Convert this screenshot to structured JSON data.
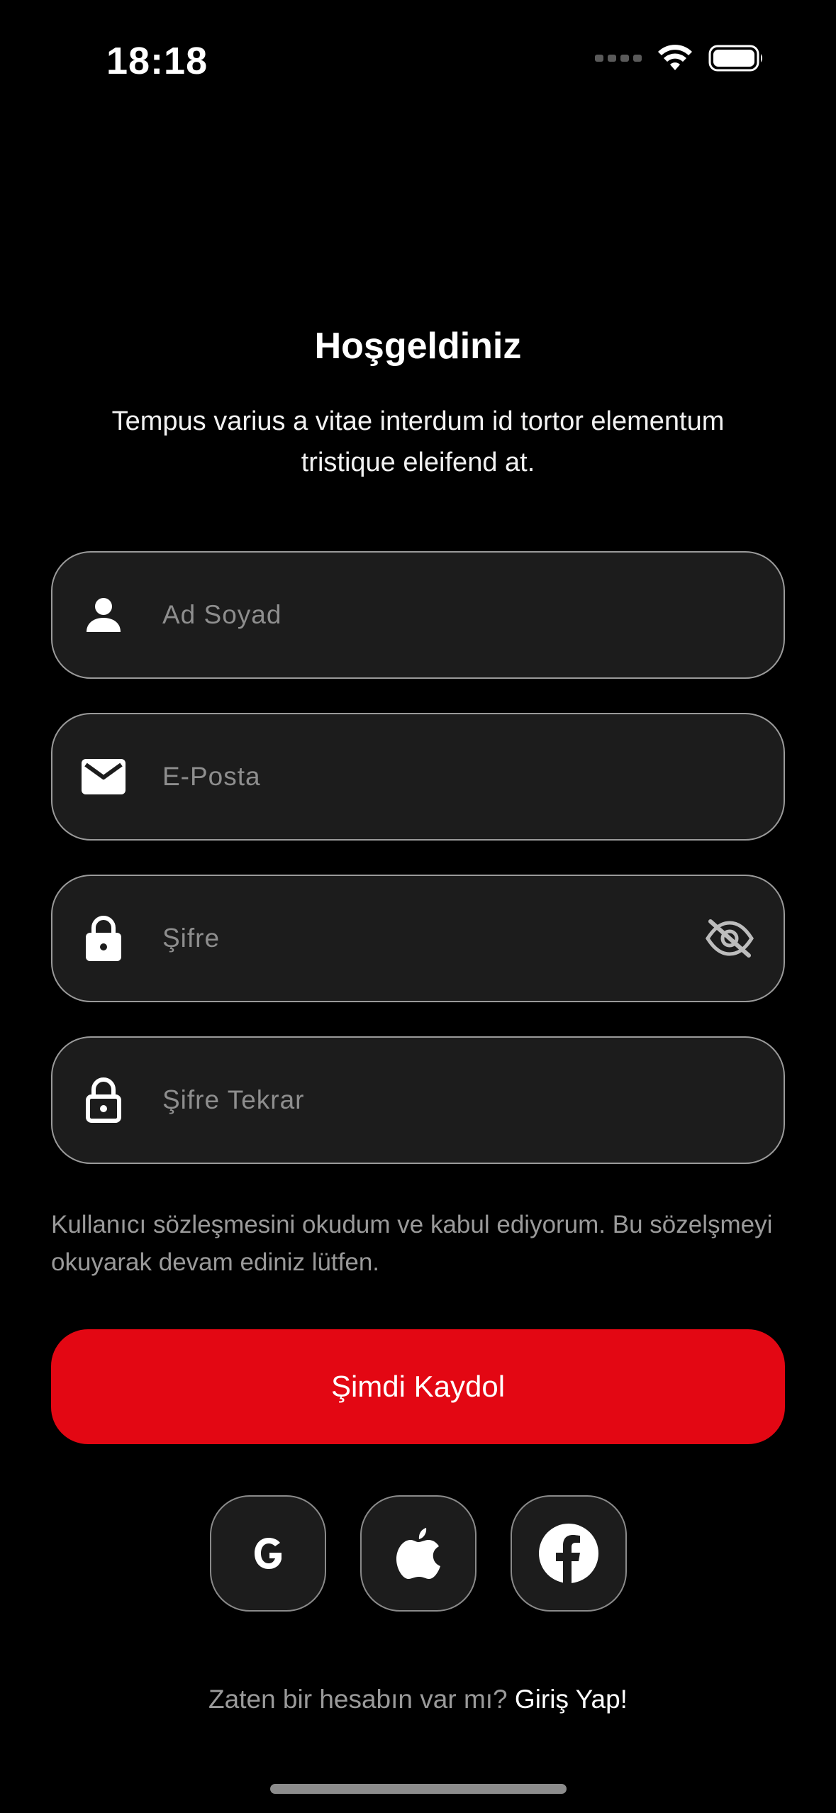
{
  "status_bar": {
    "time": "18:18"
  },
  "header": {
    "title": "Hoşgeldiniz",
    "subtitle": "Tempus varius a vitae interdum id tortor elementum tristique eleifend at."
  },
  "form": {
    "name": {
      "placeholder": "Ad Soyad",
      "value": "",
      "icon": "person-icon"
    },
    "email": {
      "placeholder": "E-Posta",
      "value": "",
      "icon": "mail-icon"
    },
    "password": {
      "placeholder": "Şifre",
      "value": "",
      "icon": "lock-icon",
      "toggle_icon": "eye-off-icon"
    },
    "password_confirm": {
      "placeholder": "Şifre Tekrar",
      "value": "",
      "icon": "lock-outline-icon"
    }
  },
  "terms_text": "Kullanıcı sözleşmesini okudum ve kabul ediyorum. Bu sözelşmeyi okuyarak devam ediniz lütfen.",
  "primary_button": {
    "label": "Şimdi Kaydol",
    "color": "#e30713"
  },
  "social_buttons": [
    {
      "name": "google",
      "icon": "google-icon"
    },
    {
      "name": "apple",
      "icon": "apple-icon"
    },
    {
      "name": "facebook",
      "icon": "facebook-icon"
    }
  ],
  "footer": {
    "prompt": "Zaten bir hesabın var mı?",
    "link": "Giriş Yap!"
  }
}
